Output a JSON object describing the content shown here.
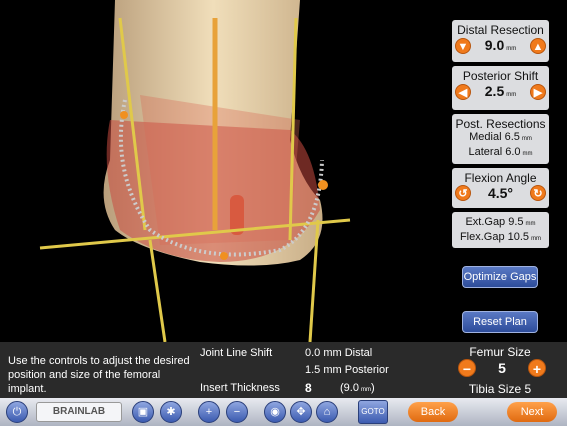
{
  "panel": {
    "distal": {
      "title": "Distal Resection",
      "value": "9.0",
      "unit": "mm"
    },
    "posterior": {
      "title": "Posterior Shift",
      "value": "2.5",
      "unit": "mm"
    },
    "post_res": {
      "title": "Post. Resections",
      "medial_label": "Medial",
      "medial_value": "6.5",
      "lateral_label": "Lateral",
      "lateral_value": "6.0",
      "unit": "mm"
    },
    "flexion": {
      "title": "Flexion Angle",
      "value": "4.5°"
    },
    "gaps": {
      "ext_label": "Ext.Gap",
      "ext_value": "9.5",
      "flex_label": "Flex.Gap",
      "flex_value": "10.5",
      "unit": "mm"
    },
    "optimize_label": "Optimize Gaps",
    "reset_label": "Reset Plan"
  },
  "info": {
    "instruction": "Use the controls to adjust the desired position and size of the femoral implant.",
    "joint_line_label": "Joint Line Shift",
    "joint_line_distal": "0.0 mm Distal",
    "joint_line_posterior": "1.5 mm Posterior",
    "insert_label": "Insert Thickness",
    "insert_value": "8",
    "insert_mm": "(9.0",
    "insert_mm_unit": "mm",
    "insert_close": ")",
    "femur_label": "Femur Size",
    "femur_value": "5",
    "tibia_label": "Tibia Size 5"
  },
  "toolbar": {
    "brand": "BRAINLAB",
    "goto": "GOTO",
    "back": "Back",
    "next": "Next"
  },
  "colors": {
    "accent": "#f07a1c",
    "panel": "#dcdde0",
    "button": "#3a5bb0"
  }
}
